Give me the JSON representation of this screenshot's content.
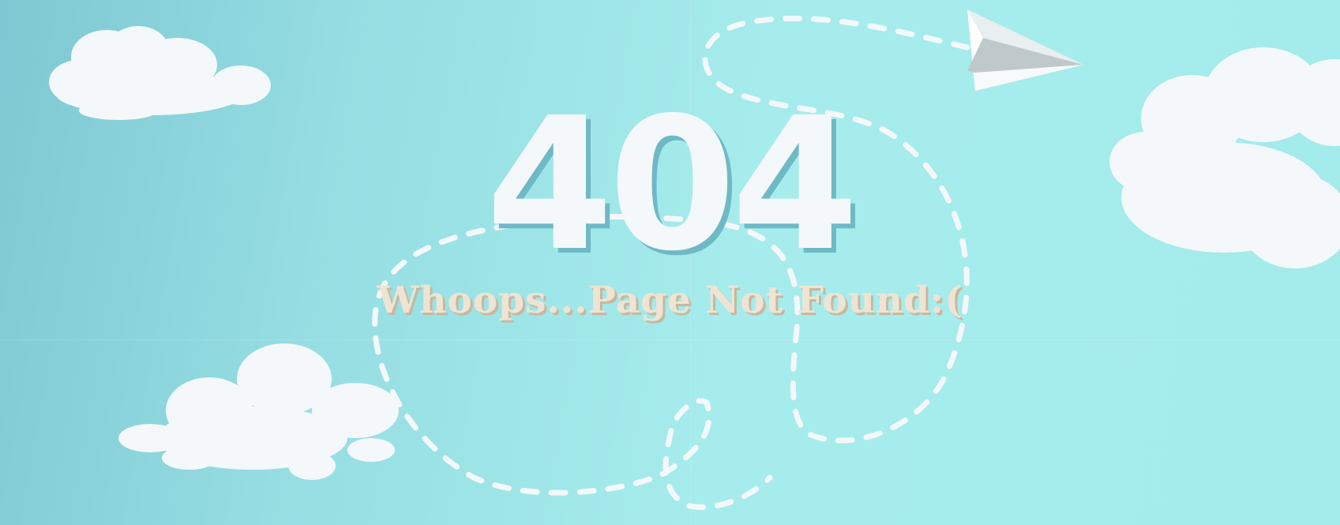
{
  "error": {
    "code": "404",
    "message": "Whoops...Page Not Found:("
  },
  "colors": {
    "sky_left": "#7ec8d3",
    "sky_right": "#a4ebeb",
    "cloud": "#f4f8fb",
    "title_shadow": "#6fb9c6",
    "subtitle_text": "#efe4d3",
    "subtitle_shadow": "#c7b89e",
    "flight_path": "#f4f8fb"
  },
  "illustration": {
    "icons": [
      "cloud-icon",
      "paper-plane-icon",
      "dashed-flight-path"
    ]
  }
}
